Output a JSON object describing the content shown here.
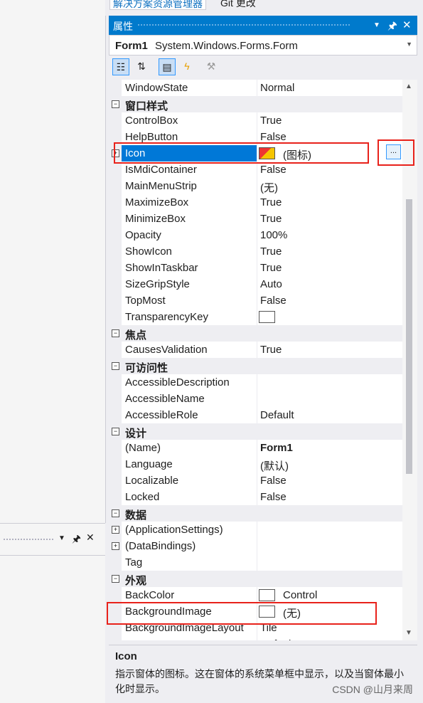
{
  "tabs": {
    "solution": "解决方案资源管理器",
    "git": "Git 更改"
  },
  "properties": {
    "title": "属性",
    "object_name": "Form1",
    "object_type": "System.Windows.Forms.Form",
    "accent": "#007acc"
  },
  "rows": [
    {
      "k": "p",
      "name": "WindowState",
      "value": "Normal"
    },
    {
      "k": "c",
      "name": "窗口样式",
      "toggle": "−"
    },
    {
      "k": "p",
      "name": "ControlBox",
      "value": "True"
    },
    {
      "k": "p",
      "name": "HelpButton",
      "value": "False"
    },
    {
      "k": "icon",
      "name": "Icon",
      "value": "(图标)",
      "toggle": "+"
    },
    {
      "k": "p",
      "name": "IsMdiContainer",
      "value": "False"
    },
    {
      "k": "p",
      "name": "MainMenuStrip",
      "value": "(无)"
    },
    {
      "k": "p",
      "name": "MaximizeBox",
      "value": "True"
    },
    {
      "k": "p",
      "name": "MinimizeBox",
      "value": "True"
    },
    {
      "k": "p",
      "name": "Opacity",
      "value": "100%"
    },
    {
      "k": "p",
      "name": "ShowIcon",
      "value": "True"
    },
    {
      "k": "p",
      "name": "ShowInTaskbar",
      "value": "True"
    },
    {
      "k": "p",
      "name": "SizeGripStyle",
      "value": "Auto"
    },
    {
      "k": "p",
      "name": "TopMost",
      "value": "False"
    },
    {
      "k": "sw",
      "name": "TransparencyKey",
      "value": ""
    },
    {
      "k": "c",
      "name": "焦点",
      "toggle": "−"
    },
    {
      "k": "p",
      "name": "CausesValidation",
      "value": "True"
    },
    {
      "k": "c",
      "name": "可访问性",
      "toggle": "−"
    },
    {
      "k": "p",
      "name": "AccessibleDescription",
      "value": ""
    },
    {
      "k": "p",
      "name": "AccessibleName",
      "value": ""
    },
    {
      "k": "p",
      "name": "AccessibleRole",
      "value": "Default"
    },
    {
      "k": "c",
      "name": "设计",
      "toggle": "−"
    },
    {
      "k": "b",
      "name": "(Name)",
      "value": "Form1"
    },
    {
      "k": "p",
      "name": "Language",
      "value": "(默认)"
    },
    {
      "k": "p",
      "name": "Localizable",
      "value": "False"
    },
    {
      "k": "p",
      "name": "Locked",
      "value": "False"
    },
    {
      "k": "c",
      "name": "数据",
      "toggle": "−"
    },
    {
      "k": "e",
      "name": "(ApplicationSettings)",
      "value": "",
      "toggle": "+"
    },
    {
      "k": "e",
      "name": "(DataBindings)",
      "value": "",
      "toggle": "+"
    },
    {
      "k": "p",
      "name": "Tag",
      "value": ""
    },
    {
      "k": "c",
      "name": "外观",
      "toggle": "−"
    },
    {
      "k": "sw",
      "name": "BackColor",
      "value": "Control"
    },
    {
      "k": "sw",
      "name": "BackgroundImage",
      "value": "(无)"
    },
    {
      "k": "p",
      "name": "BackgroundImageLayout",
      "value": "Tile"
    },
    {
      "k": "p",
      "name": "Cursor",
      "value": "Default"
    }
  ],
  "description": {
    "title": "Icon",
    "text": "指示窗体的图标。这在窗体的系统菜单框中显示，以及当窗体最小化时显示。"
  },
  "ellipsis_label": "...",
  "watermark": "CSDN @山月来周",
  "highlight_color": "#e8221b"
}
